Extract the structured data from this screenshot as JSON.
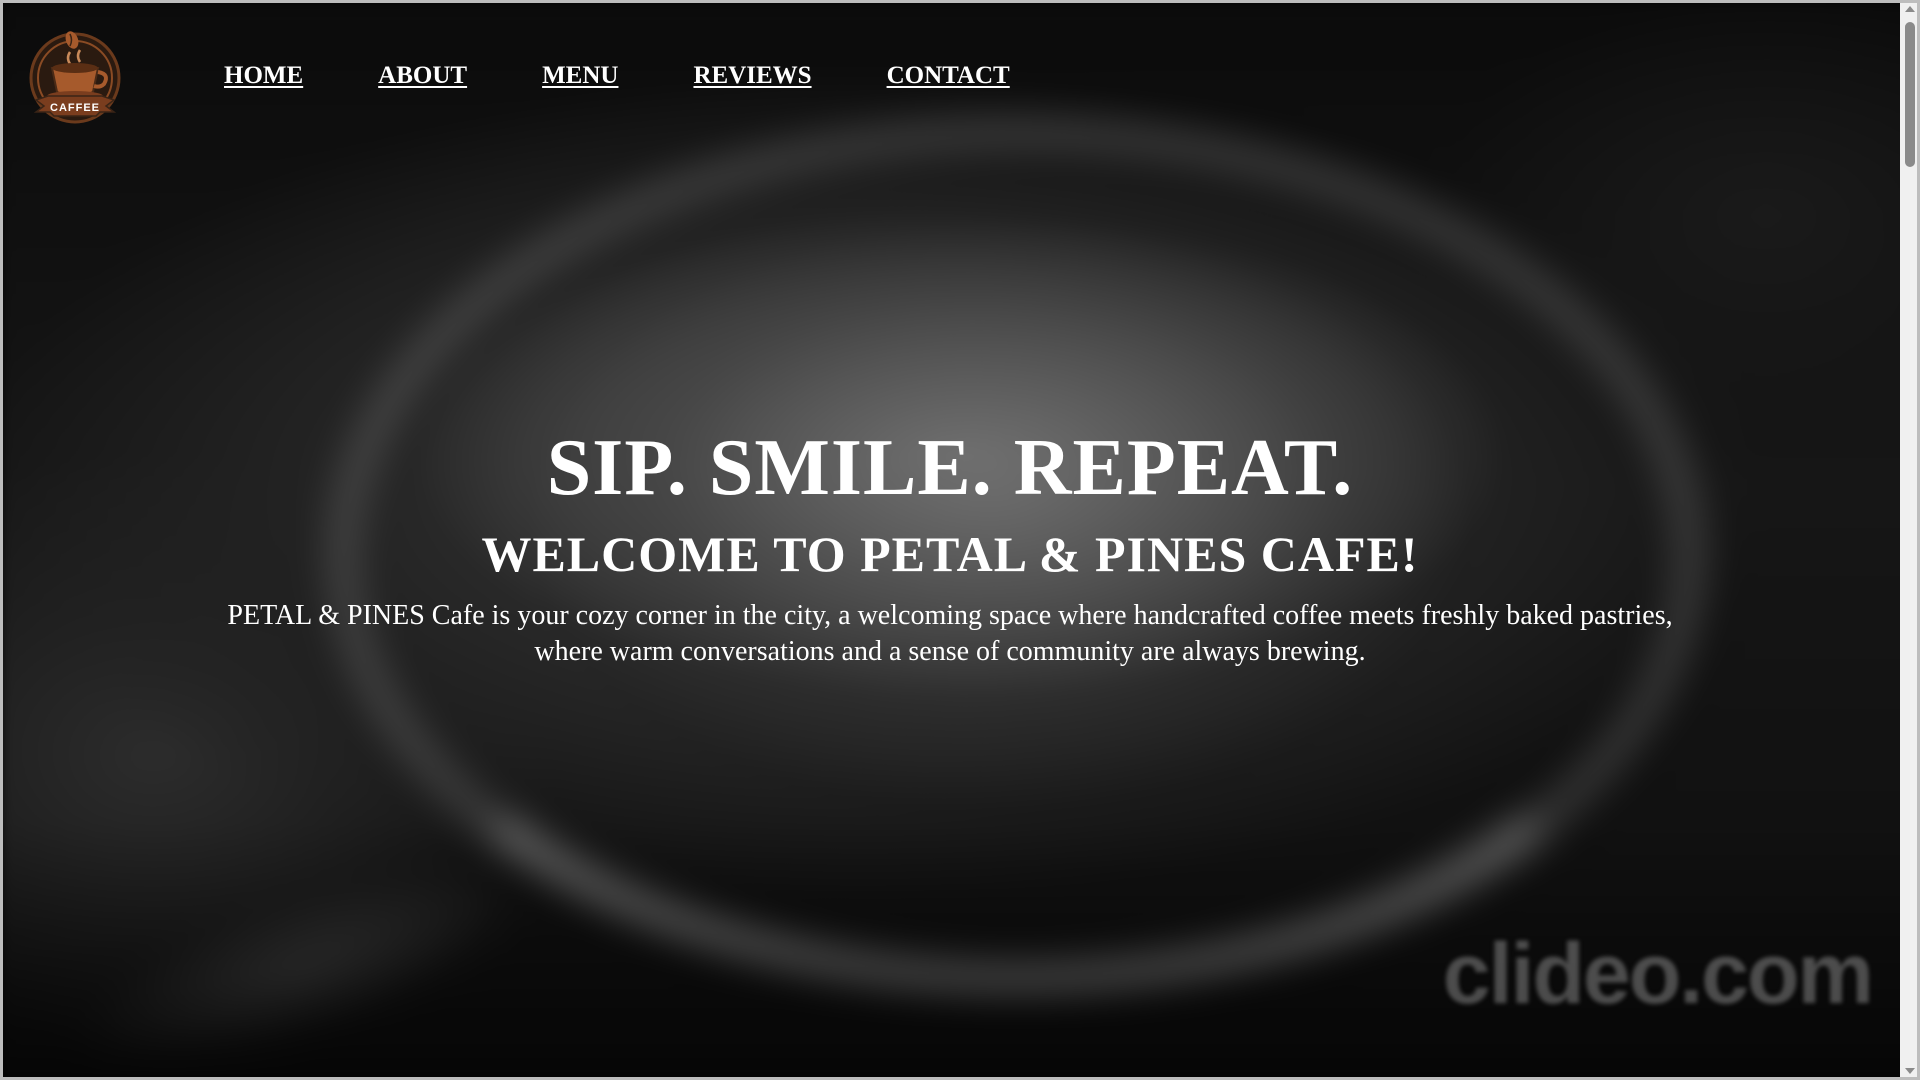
{
  "header": {
    "logo": {
      "text": "CAFFEE",
      "icon": "coffee-cup-icon",
      "colors": {
        "ribbon": "#7a3d1e",
        "cup": "#a65a2c",
        "ring": "#3a2416"
      }
    },
    "nav": [
      {
        "label": "HOME"
      },
      {
        "label": "ABOUT"
      },
      {
        "label": "MENU"
      },
      {
        "label": "REVIEWS"
      },
      {
        "label": "CONTACT"
      }
    ]
  },
  "hero": {
    "tagline": "SIP. SMILE. REPEAT.",
    "welcome": "WELCOME TO PETAL & PINES CAFE!",
    "description": "PETAL & PINES Cafe is your cozy corner in the city, a welcoming space where handcrafted coffee meets freshly baked pastries, where warm conversations and a sense of community are always brewing."
  },
  "watermark": "clideo.com",
  "colors": {
    "text": "#ffffff",
    "background": "#1a1a1a",
    "scrollbar_track": "#f0f0f0",
    "scrollbar_thumb": "#8a8a8a"
  }
}
